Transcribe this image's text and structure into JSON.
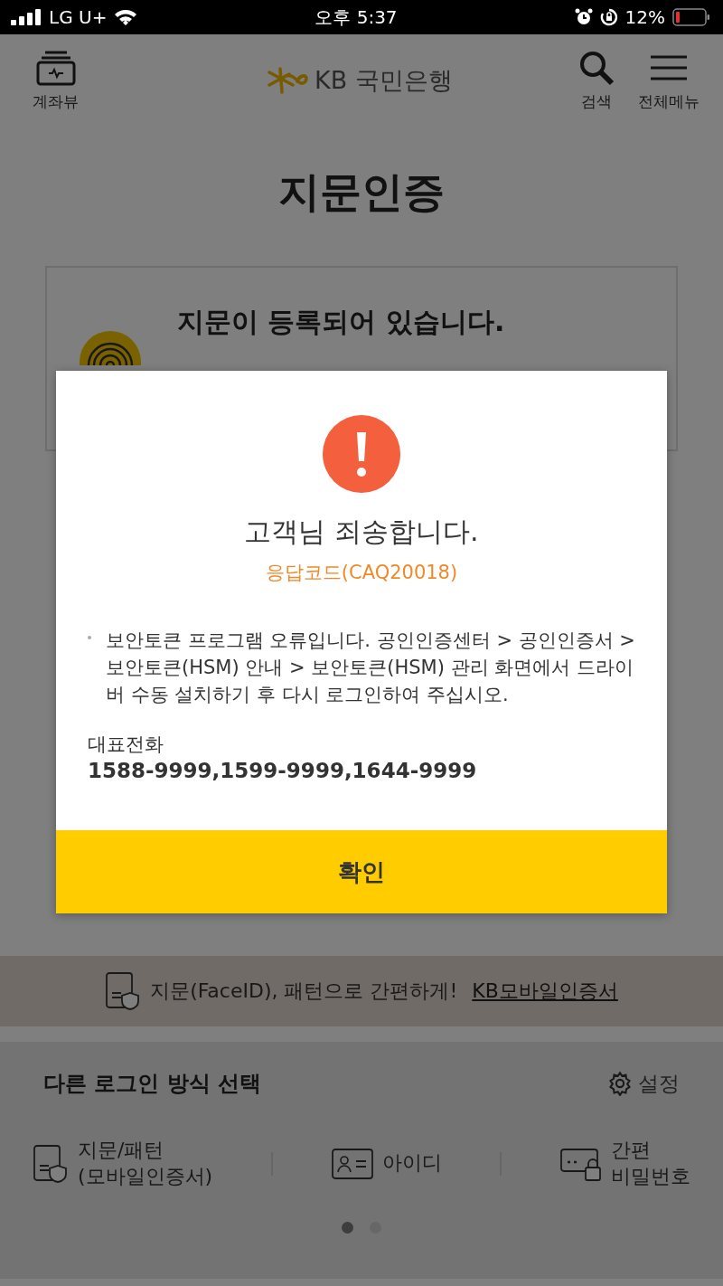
{
  "status_bar": {
    "carrier": "LG U+",
    "time": "오후 5:37",
    "battery": "12%"
  },
  "header": {
    "account_view": "계좌뷰",
    "logo": "KB 국민은행",
    "search": "검색",
    "menu": "전체메뉴"
  },
  "page_title": "지문인증",
  "card": {
    "title": "지문이 등록되어 있습니다."
  },
  "banner": {
    "text": "지문(FaceID), 패턴으로 간편하게!",
    "link": "KB모바일인증서"
  },
  "other_login": {
    "title": "다른 로그인 방식 선택",
    "settings": "설정",
    "options": [
      {
        "kind": "kb-cert",
        "lines": [
          "지문/패턴",
          "(모바일인증서)"
        ]
      },
      {
        "kind": "id-card",
        "lines": [
          "아이디"
        ]
      },
      {
        "kind": "pin",
        "lines": [
          "간편",
          "비밀번호"
        ]
      }
    ],
    "pages": [
      {
        "selected": true
      },
      {
        "selected": false
      }
    ]
  },
  "dialog": {
    "title": "고객님 죄송합니다.",
    "code": "응답코드(CAQ20018)",
    "message": "보안토큰 프로그램 오류입니다. 공인인증센터 > 공인인증서 > 보안토큰(HSM) 안내 > 보안토큰(HSM) 관리 화면에서 드라이버 수동 설치하기 후 다시 로그인하여 주십시오.",
    "phone_label": "대표전화",
    "phone_numbers": "1588-9999,1599-9999,1644-9999",
    "confirm": "확인"
  }
}
